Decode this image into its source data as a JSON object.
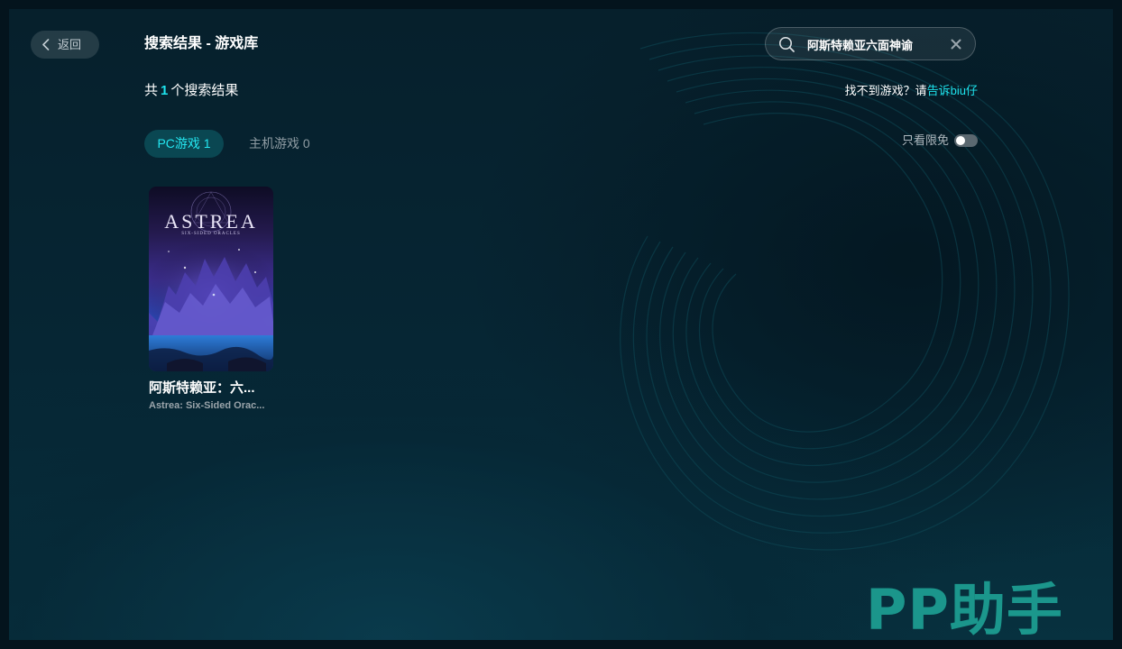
{
  "header": {
    "back_label": "返回",
    "title": "搜索结果 - 游戏库"
  },
  "search": {
    "value": "阿斯特赖亚六面神谕",
    "placeholder": ""
  },
  "results": {
    "count_prefix": "共",
    "count": "1",
    "count_suffix": "个搜索结果",
    "help_prefix": "找不到游戏？请",
    "help_link": "告诉biu仔"
  },
  "tabs": [
    {
      "label": "PC游戏 1",
      "active": true
    },
    {
      "label": "主机游戏 0",
      "active": false
    }
  ],
  "filter": {
    "label": "只看限免",
    "enabled": false
  },
  "games": [
    {
      "title": "阿斯特赖亚：六...",
      "subtitle": "Astrea: Six-Sided Orac...",
      "cover_logo": "ASTREA",
      "cover_subtitle": "SIX-SIDED ORACLES"
    }
  ],
  "watermark": "PP助手",
  "colors": {
    "accent": "#1ee4ee",
    "tab_active_bg": "#0a4752",
    "background": "#062634"
  }
}
